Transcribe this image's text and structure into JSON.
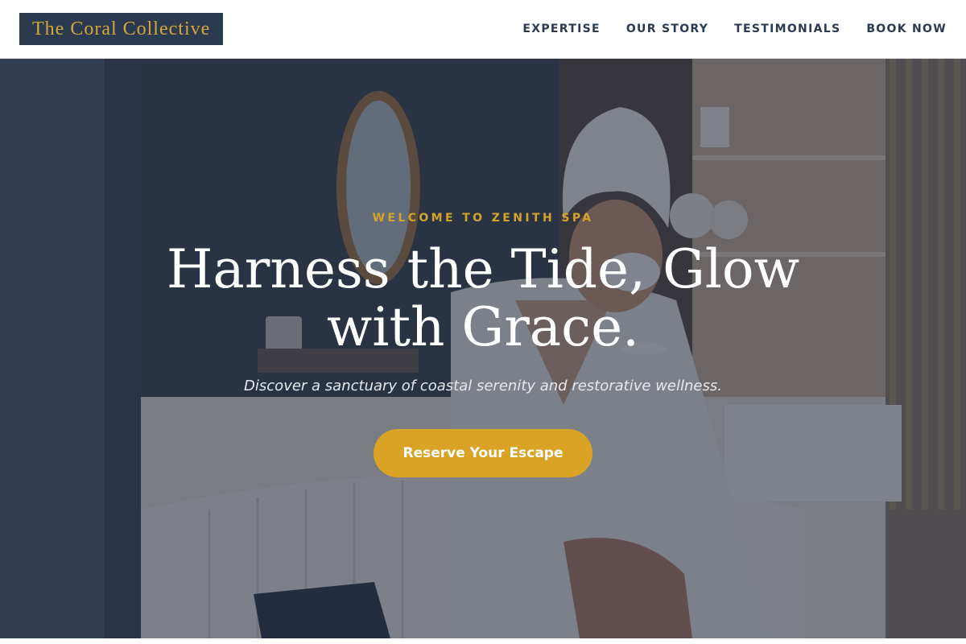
{
  "header": {
    "brand": "The Coral Collective",
    "nav": [
      {
        "label": "EXPERTISE"
      },
      {
        "label": "OUR STORY"
      },
      {
        "label": "TESTIMONIALS"
      },
      {
        "label": "BOOK NOW"
      }
    ]
  },
  "hero": {
    "eyebrow": "WELCOME TO ZENITH SPA",
    "headline_line1": "Harness the Tide, Glow",
    "headline_line2": "with Grace.",
    "subheadline": "Discover a sanctuary of coastal serenity and restorative wellness.",
    "cta_label": "Reserve Your Escape",
    "background_image": "woman in white bathrobe and towel turban sipping from a cup in a spa room"
  },
  "colors": {
    "brand_bg": "#2c3a4f",
    "brand_text": "#d4a73a",
    "nav_text": "#2c3a4f",
    "accent_gold": "#d9a326",
    "overlay": "rgba(30,38,58,0.55)"
  }
}
